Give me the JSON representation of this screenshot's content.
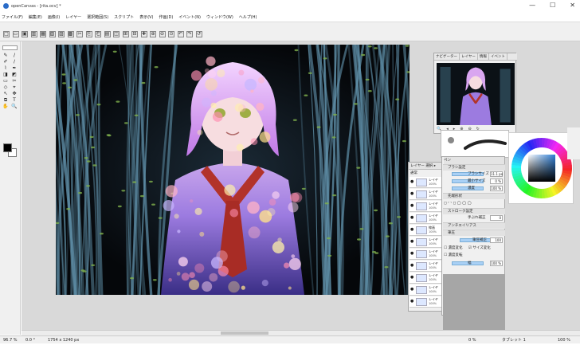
{
  "window": {
    "title": "openCanvas - [rita.ocv] *",
    "controls": [
      "—",
      "☐",
      "✕"
    ]
  },
  "menu": [
    "ファイル(F)",
    "編集(E)",
    "画像(I)",
    "レイヤー",
    "選択範囲(S)",
    "スクリプト",
    "表示(V)",
    "作画(D)",
    "イベント(N)",
    "ウィンドウ(W)",
    "ヘルプ(H)"
  ],
  "toolbar_buttons": [
    "□",
    "▭",
    "▣",
    "▥",
    "▦",
    "▧",
    "▨",
    "▩",
    "✂",
    "⎘",
    "⎗",
    "▤",
    "◫",
    "⊞",
    "⊟",
    "✚",
    "⊕",
    "⊖",
    "⊙",
    "↶",
    "↷",
    "↺"
  ],
  "tools": [
    "✎",
    "/",
    "✐",
    "∕",
    "⌇",
    "✒",
    "◨",
    "◩",
    "▭",
    "✂",
    "◇",
    "⌖",
    "↖",
    "✥",
    "⧉",
    "T",
    "✋",
    "🔍"
  ],
  "canvas": {
    "colors": {
      "bg": "#07090d",
      "tree": "#5f8fa8",
      "leaf": "#7fb04c",
      "hair": "#d9a6f0",
      "skin": "#f7d8dc",
      "uniform": "#8f6fd8",
      "scarf": "#b2332a"
    }
  },
  "navigator": {
    "tabs": [
      "ナビゲーター",
      "レイヤー",
      "情報",
      "イベント"
    ],
    "footer": [
      "🔍",
      "◂",
      "▸",
      "⊕",
      "⊖",
      "↻"
    ]
  },
  "layers": {
    "header": "レイヤー  選択  ▸",
    "mode": "通常",
    "rows": [
      {
        "name": "レイヤ",
        "pct": "100%"
      },
      {
        "name": "レイヤ",
        "pct": "100%"
      },
      {
        "name": "レイヤ",
        "pct": "100%"
      },
      {
        "name": "レイヤ",
        "pct": "100%"
      },
      {
        "name": "線画",
        "pct": "100%"
      },
      {
        "name": "レイヤ",
        "pct": "100%"
      },
      {
        "name": "レイヤ",
        "pct": "100%"
      },
      {
        "name": "レイヤ",
        "pct": "100%"
      },
      {
        "name": "レイヤ",
        "pct": "100%"
      },
      {
        "name": "レイヤ",
        "pct": "100%"
      },
      {
        "name": "レイヤ",
        "pct": "100%"
      }
    ]
  },
  "brush": {
    "header": "ペン",
    "section_basic": "ブラシ設定",
    "rows": [
      {
        "label": "ブラシサイズ",
        "value": "11.1 px"
      },
      {
        "label": "最小サイズ",
        "value": "0 %"
      },
      {
        "label": "濃度",
        "value": "100 %"
      }
    ],
    "section_shape": "先端形状",
    "section_stroke": "ストローク設定",
    "stroke_label": "手ぶれ補正",
    "stroke_value": "0",
    "section_aa": "アンチエイリアス",
    "section_water": "筆圧",
    "water_rows": [
      {
        "label": "筆圧補正",
        "value": "100"
      }
    ],
    "checks": [
      "濃度変化",
      "サイズ変化",
      "濃度反転"
    ],
    "bottom_label": "幅",
    "bottom_value": "100 %"
  },
  "status": {
    "zoom": "96.7 %",
    "angle": "0.0 °",
    "size": "1754 x 1240 px",
    "middle": "0 %",
    "tablet": "タブレット 1",
    "right": "100 %"
  }
}
